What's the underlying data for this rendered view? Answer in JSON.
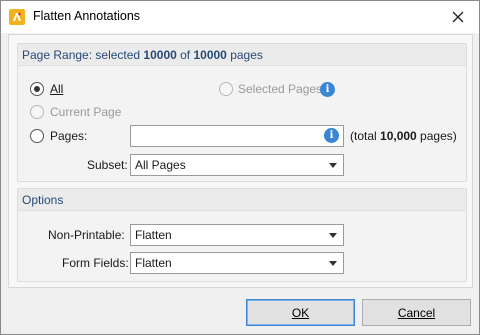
{
  "window": {
    "title": "Flatten Annotations",
    "icon": "pdf-app-icon",
    "close_icon": "close-icon"
  },
  "page_range": {
    "header_prefix": "Page Range: selected ",
    "selected_count": "10000",
    "header_of": " of ",
    "total_count": "10000",
    "header_suffix": " pages",
    "all_label": "All",
    "all_selected": true,
    "selected_pages_label": "Selected Pages",
    "current_page_label": "Current Page",
    "pages_label": "Pages:",
    "pages_value": "",
    "total_prefix": "(total ",
    "total_value": "10,000",
    "total_suffix": " pages)",
    "subset_label": "Subset:",
    "subset_value": "All Pages"
  },
  "options": {
    "header": "Options",
    "non_printable_label": "Non-Printable:",
    "non_printable_value": "Flatten",
    "form_fields_label": "Form Fields:",
    "form_fields_value": "Flatten"
  },
  "buttons": {
    "ok_label": "OK",
    "cancel_label": "Cancel"
  },
  "colors": {
    "accent": "#3a86d4",
    "header_text": "#274a78",
    "app_icon": "#f2b21b"
  }
}
